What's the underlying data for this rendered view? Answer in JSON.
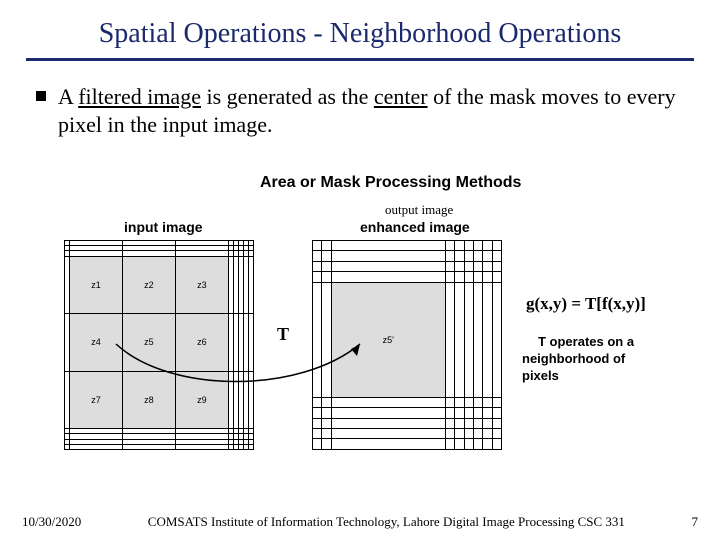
{
  "title": "Spatial Operations - Neighborhood Operations",
  "bullet": {
    "pre": "A ",
    "u1": "filtered image",
    "mid": " is generated as the ",
    "u2": "center",
    "post": " of the mask moves to every pixel in the input image."
  },
  "diagram": {
    "title": "Area or Mask Processing Methods",
    "input_label": "input image",
    "output_label": "output image",
    "enhanced_label": "enhanced image",
    "T": "T",
    "z": {
      "z1": "z1",
      "z2": "z2",
      "z3": "z3",
      "z4": "z4",
      "z5": "z5",
      "z6": "z6",
      "z7": "z7",
      "z8": "z8",
      "z9": "z9"
    },
    "z5p": "z5'",
    "eq": "g(x,y) = T[f(x,y)]",
    "caption_l1": "T operates on a",
    "caption_l2": "neighborhood of pixels"
  },
  "footer": {
    "date": "10/30/2020",
    "inst": "COMSATS Institute of Information Technology, Lahore   Digital Image Processing CSC 331",
    "page": "7"
  }
}
